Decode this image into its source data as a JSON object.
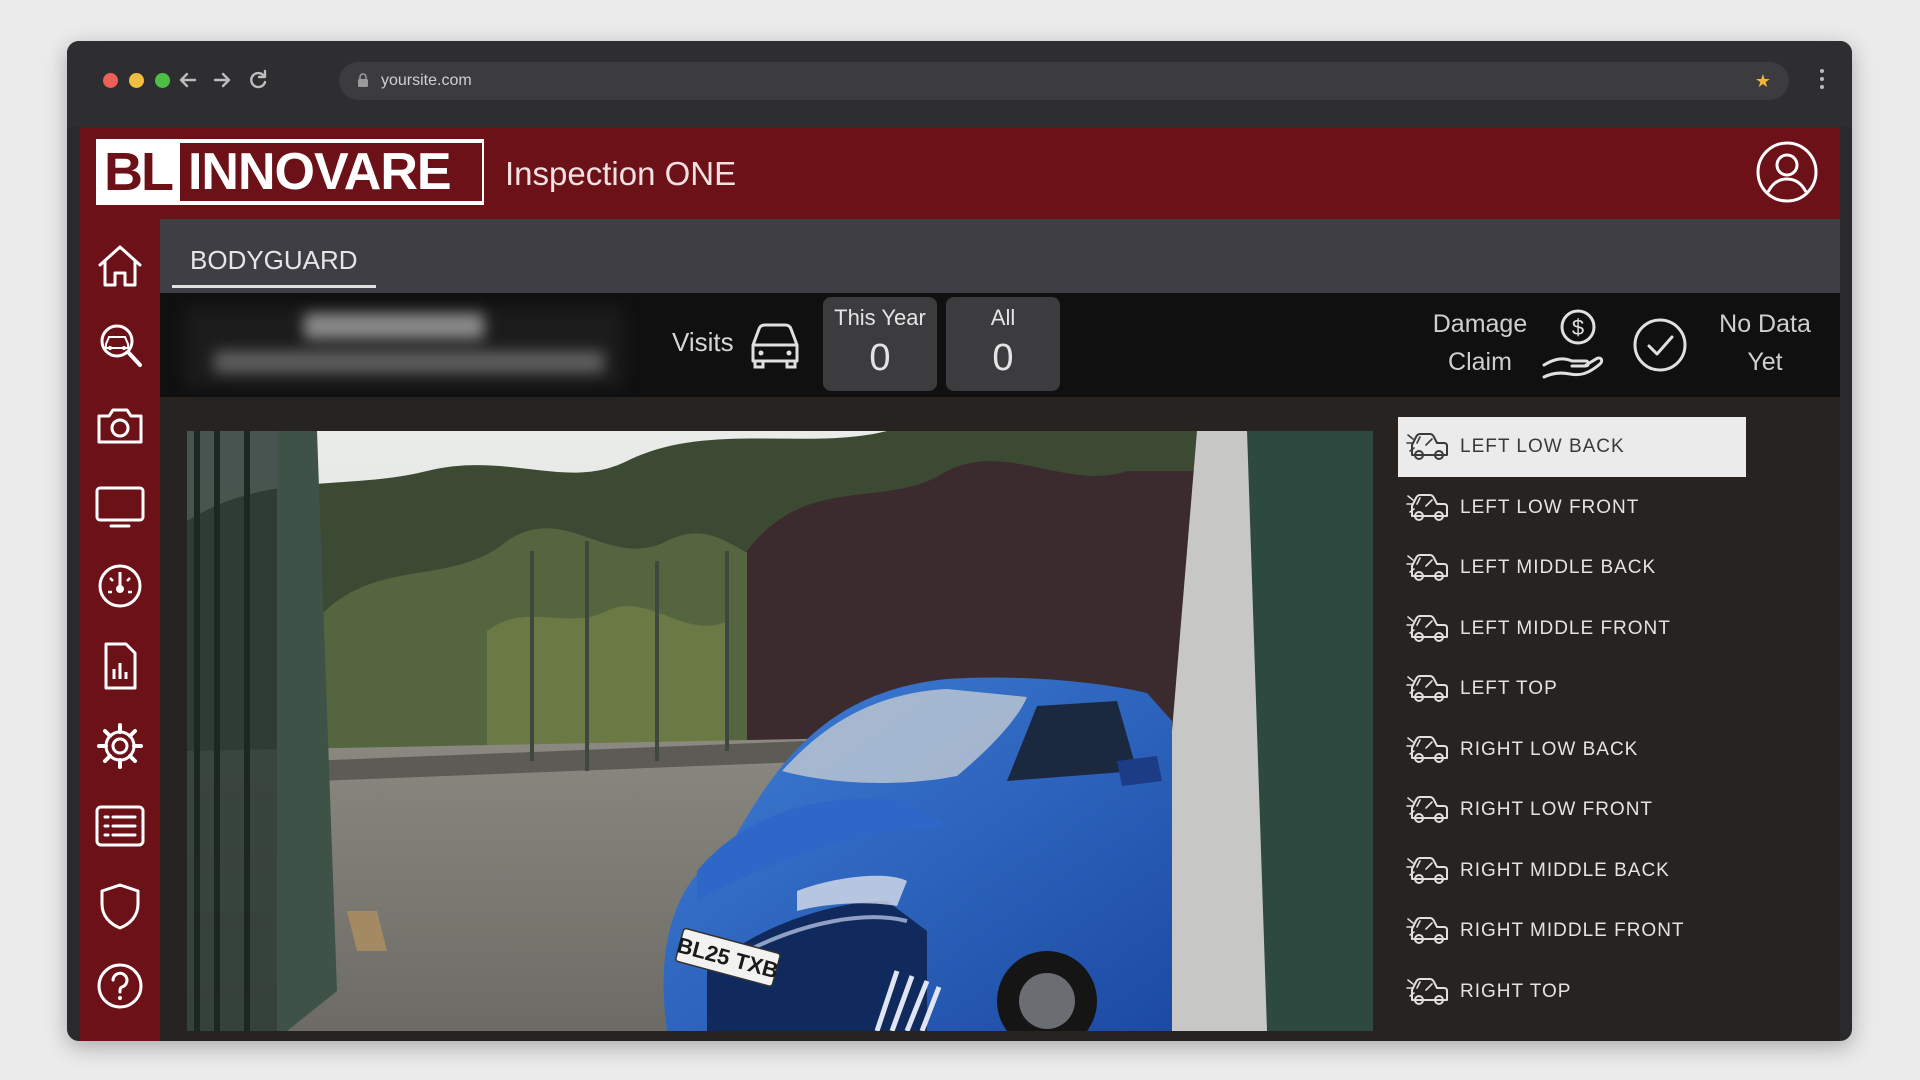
{
  "browser": {
    "url": "yoursite.com"
  },
  "header": {
    "logo_left": "BL",
    "logo_right": "INNOVARE",
    "app_title": "Inspection ONE"
  },
  "tabs": [
    {
      "label": "BODYGUARD"
    }
  ],
  "stats": {
    "visits_label": "Visits",
    "this_year_label": "This Year",
    "this_year_value": "0",
    "all_label": "All",
    "all_value": "0",
    "damage_claim_line1": "Damage",
    "damage_claim_line2": "Claim",
    "no_data_line1": "No Data",
    "no_data_line2": "Yet"
  },
  "camera": {
    "plate": "BL25 TXB"
  },
  "parts": [
    {
      "label": "LEFT LOW BACK",
      "active": true
    },
    {
      "label": "LEFT LOW FRONT"
    },
    {
      "label": "LEFT MIDDLE BACK"
    },
    {
      "label": "LEFT MIDDLE FRONT"
    },
    {
      "label": "LEFT TOP"
    },
    {
      "label": "RIGHT LOW BACK"
    },
    {
      "label": "RIGHT LOW FRONT"
    },
    {
      "label": "RIGHT MIDDLE BACK"
    },
    {
      "label": "RIGHT MIDDLE FRONT"
    },
    {
      "label": "RIGHT TOP"
    }
  ],
  "sidebar_icons": [
    "home-icon",
    "inspect-car-icon",
    "camera-icon",
    "monitor-icon",
    "dashboard-gauge-icon",
    "report-icon",
    "settings-icon",
    "list-icon",
    "shield-icon",
    "help-icon"
  ],
  "colors": {
    "brand": "#6d1119",
    "background": "#1f1c1b",
    "active_item": "#ebebeb"
  }
}
